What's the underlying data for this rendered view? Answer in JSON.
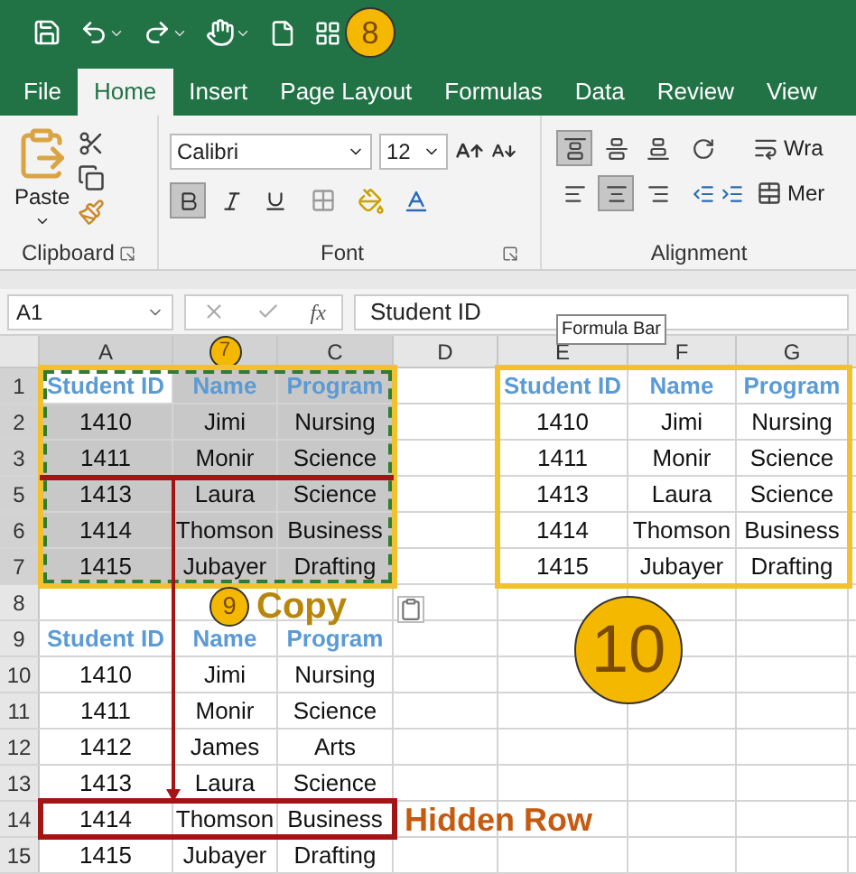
{
  "quick_access": {
    "badge": "8"
  },
  "tabs": [
    {
      "label": "File",
      "selected": false
    },
    {
      "label": "Home",
      "selected": true
    },
    {
      "label": "Insert",
      "selected": false
    },
    {
      "label": "Page Layout",
      "selected": false
    },
    {
      "label": "Formulas",
      "selected": false
    },
    {
      "label": "Data",
      "selected": false
    },
    {
      "label": "Review",
      "selected": false
    },
    {
      "label": "View",
      "selected": false
    }
  ],
  "ribbon": {
    "paste_label": "Paste",
    "groups": [
      "Clipboard",
      "Font",
      "Alignment"
    ],
    "font": {
      "name": "Calibri",
      "size": "12",
      "bold": true,
      "italic": false,
      "underline": false
    },
    "alignment": {
      "vertical": [
        {
          "kind": "top",
          "selected": true
        },
        {
          "kind": "middle",
          "selected": false
        },
        {
          "kind": "bottom",
          "selected": false
        }
      ],
      "horizontal": [
        {
          "kind": "left",
          "selected": false
        },
        {
          "kind": "center",
          "selected": true
        },
        {
          "kind": "right",
          "selected": false
        }
      ],
      "wrap_label": "Wra",
      "merge_label": "Mer"
    }
  },
  "formula_bar": {
    "name_box": "A1",
    "function_label": "fx",
    "value": "Student ID",
    "tooltip": "Formula Bar"
  },
  "columns": [
    {
      "label": "A",
      "copied": true
    },
    {
      "badge": "7",
      "copied": true
    },
    {
      "label": "C",
      "copied": true
    },
    {
      "label": "D",
      "copied": false
    },
    {
      "label": "E",
      "copied": false
    },
    {
      "label": "F",
      "copied": false
    },
    {
      "label": "G",
      "copied": false
    }
  ],
  "rows": [
    {
      "number": "1",
      "copied": true,
      "left": {
        "kind": "header",
        "cells": [
          "Student ID",
          "Name",
          "Program"
        ]
      },
      "right": {
        "kind": "header",
        "cells": [
          "Student ID",
          "Name",
          "Program"
        ]
      }
    },
    {
      "number": "2",
      "copied": true,
      "left": {
        "kind": "data",
        "cells": [
          "1410",
          "Jimi",
          "Nursing"
        ]
      },
      "right": {
        "kind": "data",
        "cells": [
          "1410",
          "Jimi",
          "Nursing"
        ]
      }
    },
    {
      "number": "3",
      "copied": true,
      "hidden_after": true,
      "left": {
        "kind": "data",
        "cells": [
          "1411",
          "Monir",
          "Science"
        ]
      },
      "right": {
        "kind": "data",
        "cells": [
          "1411",
          "Monir",
          "Science"
        ]
      }
    },
    {
      "number": "5",
      "copied": true,
      "left": {
        "kind": "data",
        "cells": [
          "1413",
          "Laura",
          "Science"
        ]
      },
      "right": {
        "kind": "data",
        "cells": [
          "1413",
          "Laura",
          "Science"
        ]
      }
    },
    {
      "number": "6",
      "copied": true,
      "left": {
        "kind": "data",
        "cells": [
          "1414",
          "Thomson",
          "Business"
        ]
      },
      "right": {
        "kind": "data",
        "cells": [
          "1414",
          "Thomson",
          "Business"
        ]
      }
    },
    {
      "number": "7",
      "copied": true,
      "left": {
        "kind": "data",
        "cells": [
          "1415",
          "Jubayer",
          "Drafting"
        ]
      },
      "right": {
        "kind": "data",
        "cells": [
          "1415",
          "Jubayer",
          "Drafting"
        ]
      }
    },
    {
      "number": "8",
      "copied": false
    },
    {
      "number": "9",
      "copied": false,
      "left": {
        "kind": "header",
        "cells": [
          "Student ID",
          "Name",
          "Program"
        ]
      }
    },
    {
      "number": "10",
      "copied": false,
      "left": {
        "kind": "data",
        "cells": [
          "1410",
          "Jimi",
          "Nursing"
        ]
      }
    },
    {
      "number": "11",
      "copied": false,
      "left": {
        "kind": "data",
        "cells": [
          "1411",
          "Monir",
          "Science"
        ]
      }
    },
    {
      "number": "12",
      "copied": false,
      "left": {
        "kind": "data",
        "cells": [
          "1412",
          "James",
          "Arts"
        ]
      }
    },
    {
      "number": "13",
      "copied": false,
      "left": {
        "kind": "data",
        "cells": [
          "1413",
          "Laura",
          "Science"
        ]
      }
    },
    {
      "number": "14",
      "copied": false,
      "highlighted": true,
      "left": {
        "kind": "data",
        "cells": [
          "1414",
          "Thomson",
          "Business"
        ]
      }
    },
    {
      "number": "15",
      "copied": false,
      "left": {
        "kind": "data",
        "cells": [
          "1415",
          "Jubayer",
          "Drafting"
        ]
      }
    }
  ],
  "annotations": {
    "copy_badge": "9",
    "copy_label": "Copy",
    "result_badge": "10",
    "hidden_label": "Hidden Row"
  }
}
